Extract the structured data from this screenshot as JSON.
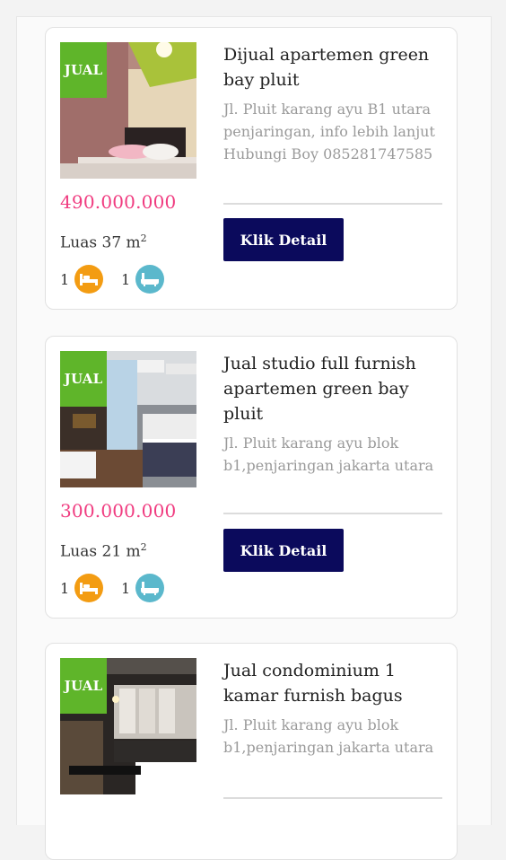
{
  "listings": [
    {
      "badge": "JUAL",
      "title": "Dijual apartemen green bay pluit",
      "address": "Jl. Pluit karang ayu B1 utara penjaringan, info lebih lanjut Hubungi Boy 085281747585",
      "price": "490.000.000",
      "area_prefix": "Luas 37 m",
      "area_sup": "2",
      "bedrooms": "1",
      "bathrooms": "1",
      "button": "Klik Detail"
    },
    {
      "badge": "JUAL",
      "title": "Jual studio full furnish apartemen green bay pluit",
      "address": "Jl. Pluit karang ayu blok b1,penjaringan jakarta utara",
      "price": "300.000.000",
      "area_prefix": "Luas 21 m",
      "area_sup": "2",
      "bedrooms": "1",
      "bathrooms": "1",
      "button": "Klik Detail"
    },
    {
      "badge": "JUAL",
      "title": "Jual condominium 1 kamar furnish bagus",
      "address": "Jl. Pluit karang ayu blok b1,penjaringan jakarta utara"
    }
  ],
  "colors": {
    "badge": "#5fb52a",
    "price": "#f03c80",
    "button": "#0b0a5c",
    "bed_icon": "#f39c12",
    "bath_icon": "#5bb8cc"
  },
  "icons": [
    "bed-icon",
    "bathtub-icon"
  ]
}
